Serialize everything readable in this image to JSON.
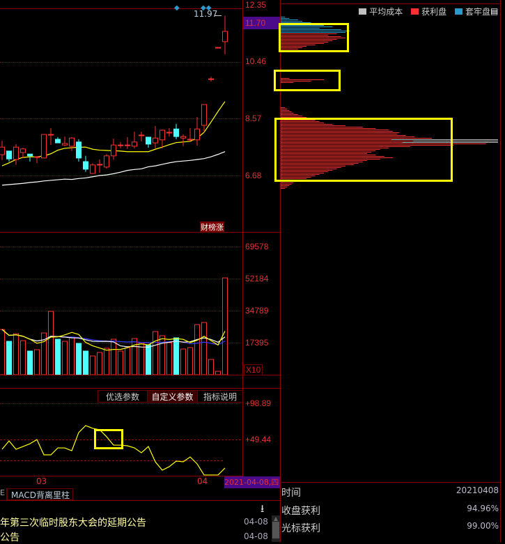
{
  "colors": {
    "up": "#ff3030",
    "down": "#50ffff",
    "ma1": "#ffff00",
    "ma2": "#ffffff",
    "vma3": "#3a3aff",
    "accent_bg": "#4a0a8a",
    "profit": "#ff3030",
    "trapped": "#2a9acc",
    "avg": "#c0c0c0"
  },
  "price_axis": {
    "labels": [
      "12.35",
      "11.70",
      "10.46",
      "8.57",
      "6.68"
    ],
    "current": "11.70",
    "high_label": "11.97"
  },
  "chart_data": {
    "type": "candlestick",
    "candles": [
      [
        7.37,
        7.83,
        7.19,
        7.62
      ],
      [
        7.49,
        7.49,
        7.14,
        7.23
      ],
      [
        7.21,
        7.72,
        7.03,
        7.62
      ],
      [
        7.44,
        7.6,
        7.26,
        7.56
      ],
      [
        7.39,
        7.39,
        7.14,
        7.33
      ],
      [
        7.3,
        7.3,
        7.09,
        7.3
      ],
      [
        7.26,
        8.04,
        7.26,
        8.04
      ],
      [
        8.04,
        8.25,
        7.69,
        8.04
      ],
      [
        7.88,
        7.95,
        7.76,
        7.76
      ],
      [
        7.69,
        7.97,
        7.65,
        7.74
      ],
      [
        7.65,
        7.95,
        7.49,
        7.92
      ],
      [
        7.79,
        7.88,
        7.14,
        7.26
      ],
      [
        7.14,
        7.33,
        6.8,
        6.89
      ],
      [
        6.75,
        7.09,
        6.75,
        7.03
      ],
      [
        7.05,
        7.21,
        6.77,
        7.05
      ],
      [
        6.96,
        7.39,
        6.91,
        7.33
      ],
      [
        7.33,
        7.9,
        7.21,
        7.69
      ],
      [
        7.69,
        7.79,
        7.58,
        7.69
      ],
      [
        7.69,
        7.95,
        7.56,
        7.69
      ],
      [
        7.65,
        8.13,
        7.58,
        7.79
      ],
      [
        8.02,
        8.13,
        7.81,
        8.02
      ],
      [
        7.95,
        7.95,
        7.6,
        7.72
      ],
      [
        7.76,
        8.32,
        7.58,
        7.92
      ],
      [
        7.86,
        8.2,
        7.58,
        8.18
      ],
      [
        8.11,
        8.25,
        7.97,
        8.11
      ],
      [
        8.22,
        8.39,
        7.88,
        7.97
      ],
      [
        7.92,
        8.04,
        7.65,
        7.97
      ],
      [
        7.88,
        8.25,
        7.81,
        7.88
      ],
      [
        7.86,
        8.62,
        7.67,
        8.22
      ],
      [
        8.34,
        9.03,
        8.11,
        9.03
      ],
      [
        9.88,
        9.95,
        9.79,
        9.88
      ],
      [
        10.92,
        10.92,
        10.92,
        10.92
      ],
      [
        11.11,
        11.97,
        10.69,
        11.45
      ]
    ],
    "ma_short": [
      7.0,
      7.1,
      7.21,
      7.28,
      7.3,
      7.3,
      7.33,
      7.4,
      7.52,
      7.58,
      7.6,
      7.62,
      7.62,
      7.55,
      7.52,
      7.51,
      7.5,
      7.49,
      7.47,
      7.47,
      7.47,
      7.47,
      7.55,
      7.62,
      7.7,
      7.77,
      7.79,
      7.81,
      7.92,
      8.11,
      8.45,
      8.8,
      9.13
    ],
    "ma_long": [
      6.36,
      6.38,
      6.4,
      6.42,
      6.45,
      6.47,
      6.5,
      6.52,
      6.54,
      6.56,
      6.55,
      6.58,
      6.6,
      6.64,
      6.68,
      6.7,
      6.74,
      6.79,
      6.85,
      6.88,
      6.9,
      6.97,
      7.0,
      7.05,
      7.1,
      7.14,
      7.16,
      7.18,
      7.21,
      7.24,
      7.3,
      7.38,
      7.47
    ],
    "price_range": [
      6.0,
      12.45
    ],
    "volume": [
      24570,
      18144,
      22302,
      18522,
      12852,
      13608,
      22680,
      34398,
      19278,
      18144,
      20412,
      17010,
      12852,
      10206,
      12096,
      14364,
      19278,
      12852,
      14742,
      19656,
      17388,
      16254,
      23436,
      21168,
      17388,
      20034,
      13986,
      14742,
      27216,
      28350,
      8316,
      1890,
      52542
    ],
    "volume_axis": [
      "69578",
      "52184",
      "34789",
      "17395"
    ],
    "volume_unit": "X10",
    "oscillator": [
      36.1,
      47.6,
      36.1,
      39.9,
      43.7,
      49.4,
      28.5,
      28.5,
      38.0,
      38.0,
      34.2,
      59.0,
      68.5,
      64.7,
      62.8,
      53.3,
      41.8,
      41.8,
      40.9,
      38.0,
      31.4,
      39.9,
      19.0,
      7.6,
      12.4,
      20.0,
      19.0,
      25.7,
      16.2,
      1.0,
      1.0,
      1.0,
      10.5
    ],
    "oscillator_axis": [
      "+98.89",
      "+49.44"
    ],
    "x_labels": [
      "03",
      "04"
    ]
  },
  "badge": "财榜涨",
  "indicator_tabs": [
    "优选参数",
    "自定义参数",
    "指标说明"
  ],
  "date_label": "2021-04-08,四",
  "bottom_tabs": [
    "E",
    "MACD背离里柱"
  ],
  "news": [
    {
      "title": "年第三次临时股东大会的延期公告",
      "date": "04-08"
    },
    {
      "title": "公告",
      "date": "04-08"
    }
  ],
  "chips": {
    "legend": [
      "平均成本",
      "获利盘",
      "套牢盘"
    ],
    "step": 0.046,
    "clusters": [
      {
        "start_price": 11.94,
        "trapped_rows": 12,
        "values": [
          2,
          4,
          8,
          10,
          14,
          12,
          20,
          24,
          18,
          28,
          32,
          30,
          26,
          22,
          28,
          30,
          26,
          24,
          22,
          20,
          16,
          12,
          10,
          8,
          6,
          4
        ]
      },
      {
        "start_price": 9.91,
        "trapped_rows": 0,
        "values": [
          4,
          20,
          14,
          6
        ]
      },
      {
        "start_price": 8.94,
        "trapped_rows": 0,
        "values": [
          2,
          3,
          4,
          5,
          6,
          8,
          10,
          12,
          14,
          16,
          18,
          20,
          24,
          30,
          38,
          44,
          50,
          52,
          55,
          54,
          58,
          62,
          70,
          80,
          90,
          100,
          95,
          80,
          60,
          50,
          46,
          44,
          42,
          40,
          44,
          48,
          52,
          46,
          40,
          38,
          36,
          34,
          30,
          28,
          26,
          24,
          22,
          20,
          18,
          16,
          14,
          12,
          10,
          8,
          6,
          5,
          4,
          3,
          2
        ]
      }
    ]
  },
  "info": [
    {
      "label": "时间",
      "value": "20210408"
    },
    {
      "label": "收盘获利",
      "value": "94.96%"
    },
    {
      "label": "光标获利",
      "value": "99.00%"
    }
  ]
}
